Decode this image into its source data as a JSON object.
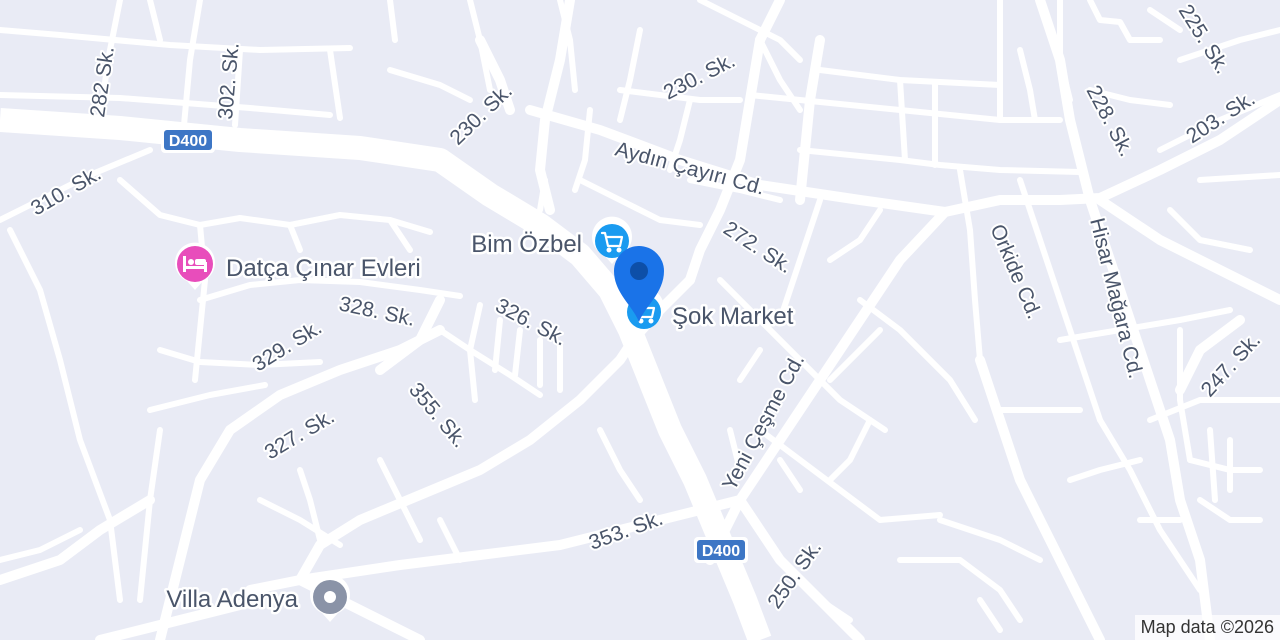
{
  "colors": {
    "background": "#e9ebf5",
    "road": "#ffffff",
    "label": "#4a556a",
    "shopping_pin": "#1a9bf0",
    "lodging_pin": "#e84dbb",
    "place_pin": "#8a93a7",
    "location_pin": "#1a73e8",
    "shield": "#3d76c5"
  },
  "highway_shields": [
    {
      "id": "d400-west",
      "text": "D400"
    },
    {
      "id": "d400-south",
      "text": "D400"
    }
  ],
  "street_labels": [
    {
      "id": "282",
      "text": "282 Sk."
    },
    {
      "id": "302",
      "text": "302. Sk."
    },
    {
      "id": "310",
      "text": "310. Sk."
    },
    {
      "id": "230a",
      "text": "230. Sk."
    },
    {
      "id": "230b",
      "text": "230. Sk."
    },
    {
      "id": "aydin",
      "text": "Aydın Çayırı Cd."
    },
    {
      "id": "225",
      "text": "225. Sk."
    },
    {
      "id": "228",
      "text": "228. Sk."
    },
    {
      "id": "203",
      "text": "203. Sk."
    },
    {
      "id": "272",
      "text": "272. Sk."
    },
    {
      "id": "orkide",
      "text": "Orkide Cd."
    },
    {
      "id": "hisar",
      "text": "Hisar Mağara Cd."
    },
    {
      "id": "247",
      "text": "247. Sk."
    },
    {
      "id": "328",
      "text": "328. Sk."
    },
    {
      "id": "329",
      "text": "329. Sk."
    },
    {
      "id": "326",
      "text": "326. Sk."
    },
    {
      "id": "327",
      "text": "327. Sk."
    },
    {
      "id": "355",
      "text": "355. Sk."
    },
    {
      "id": "yeni",
      "text": "Yeni Çeşme Cd."
    },
    {
      "id": "353",
      "text": "353. Sk."
    },
    {
      "id": "250",
      "text": "250. Sk."
    }
  ],
  "places": [
    {
      "id": "bim",
      "label": "Bim Özbel",
      "icon": "shopping-cart-icon",
      "color": "#1a9bf0",
      "text_color": "#1a73c8"
    },
    {
      "id": "sok",
      "label": "Şok Market",
      "icon": "shopping-cart-icon",
      "color": "#1a9bf0",
      "text_color": "#1a73c8"
    },
    {
      "id": "cinar",
      "label": "Datça Çınar Evleri",
      "icon": "bed-icon",
      "color": "#e84dbb",
      "text_color": "#4a556a"
    },
    {
      "id": "villa",
      "label": "Villa Adenya",
      "icon": "place-icon",
      "color": "#8a93a7",
      "text_color": "#4a556a"
    }
  ],
  "location_marker": {
    "icon": "map-marker-icon",
    "color": "#1a73e8"
  },
  "attribution": "Map data ©2026"
}
